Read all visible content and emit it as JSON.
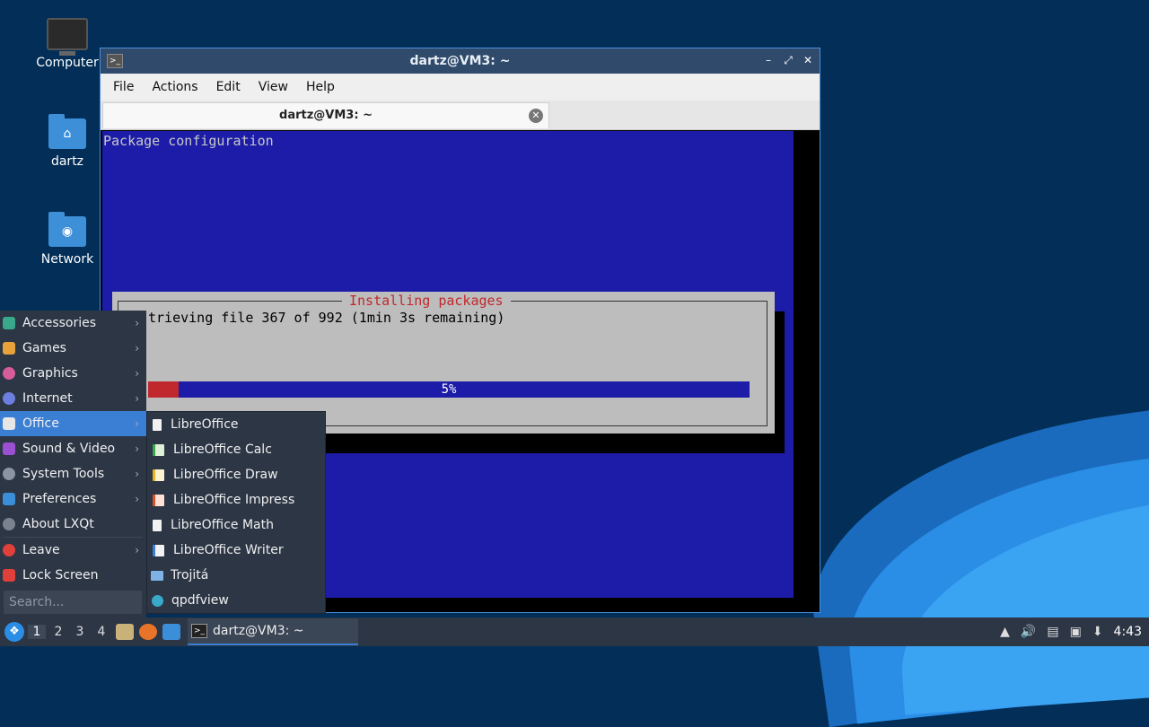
{
  "desktop": {
    "icons": [
      {
        "label": "Computer"
      },
      {
        "label": "dartz"
      },
      {
        "label": "Network"
      }
    ]
  },
  "window": {
    "title": "dartz@VM3: ~",
    "menu": [
      "File",
      "Actions",
      "Edit",
      "View",
      "Help"
    ],
    "tab_title": "dartz@VM3: ~",
    "icon_name": "terminal-icon"
  },
  "terminal": {
    "header": "Package configuration",
    "dialog_title": "Installing packages",
    "status_line": "trieving file 367 of 992 (1min 3s remaining)",
    "progress_percent": 5,
    "progress_label": "5%",
    "colors": {
      "background": "#1c1ca8",
      "dialog": "#bdbdbd",
      "accent": "#c0282d"
    }
  },
  "start_menu": {
    "items": [
      {
        "label": "Accessories",
        "icon": "accessories-icon",
        "submenu": true
      },
      {
        "label": "Games",
        "icon": "games-icon",
        "submenu": true
      },
      {
        "label": "Graphics",
        "icon": "graphics-icon",
        "submenu": true
      },
      {
        "label": "Internet",
        "icon": "internet-icon",
        "submenu": true
      },
      {
        "label": "Office",
        "icon": "office-icon",
        "submenu": true,
        "active": true
      },
      {
        "label": "Sound & Video",
        "icon": "sound-video-icon",
        "submenu": true
      },
      {
        "label": "System Tools",
        "icon": "system-tools-icon",
        "submenu": true
      },
      {
        "label": "Preferences",
        "icon": "preferences-icon",
        "submenu": true
      },
      {
        "label": "About LXQt",
        "icon": "info-icon",
        "submenu": false
      },
      {
        "label": "Leave",
        "icon": "power-icon",
        "submenu": true
      },
      {
        "label": "Lock Screen",
        "icon": "lock-icon",
        "submenu": false
      }
    ],
    "search_placeholder": "Search..."
  },
  "office_submenu": {
    "items": [
      {
        "label": "LibreOffice",
        "icon": "libreoffice-icon"
      },
      {
        "label": "LibreOffice Calc",
        "icon": "libreoffice-calc-icon"
      },
      {
        "label": "LibreOffice Draw",
        "icon": "libreoffice-draw-icon"
      },
      {
        "label": "LibreOffice Impress",
        "icon": "libreoffice-impress-icon"
      },
      {
        "label": "LibreOffice Math",
        "icon": "libreoffice-math-icon"
      },
      {
        "label": "LibreOffice Writer",
        "icon": "libreoffice-writer-icon"
      },
      {
        "label": "Trojitá",
        "icon": "mail-icon"
      },
      {
        "label": "qpdfview",
        "icon": "pdf-viewer-icon"
      }
    ]
  },
  "taskbar": {
    "desktops": [
      "1",
      "2",
      "3",
      "4"
    ],
    "active_desktop": "1",
    "task_label": "dartz@VM3: ~",
    "clock": "4:43"
  }
}
